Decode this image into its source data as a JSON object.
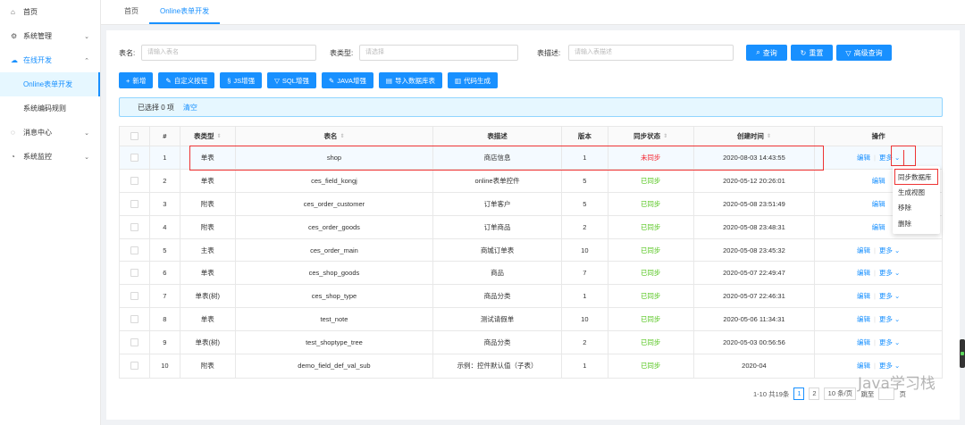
{
  "sidebar": {
    "items": [
      {
        "label": "首页",
        "icon": "home-icon"
      },
      {
        "label": "系统管理",
        "icon": "gear-icon"
      },
      {
        "label": "在线开发",
        "icon": "cloud-icon"
      },
      {
        "label": "Online表单开发"
      },
      {
        "label": "系统编码规则"
      },
      {
        "label": "消息中心",
        "icon": "message-icon"
      },
      {
        "label": "系统监控",
        "icon": "monitor-icon"
      }
    ]
  },
  "tabs": [
    "首页",
    "Online表单开发"
  ],
  "search": {
    "table_name_label": "表名:",
    "table_name_placeholder": "请输入表名",
    "table_type_label": "表类型:",
    "table_type_placeholder": "请选择",
    "table_desc_label": "表描述:",
    "table_desc_placeholder": "请输入表描述",
    "query": "查询",
    "reset": "重置",
    "advanced": "高级查询"
  },
  "toolbar": [
    "新增",
    "自定义按钮",
    "JS增强",
    "SQL增强",
    "JAVA增强",
    "导入数据库表",
    "代码生成"
  ],
  "alert": {
    "selected": "已选择 0 项",
    "clear": "清空"
  },
  "table": {
    "headers": [
      "#",
      "表类型",
      "表名",
      "表描述",
      "版本",
      "同步状态",
      "创建时间",
      "操作"
    ],
    "rows": [
      {
        "no": "1",
        "type": "单表",
        "name": "shop",
        "desc": "商店信息",
        "ver": "1",
        "sync": "未同步",
        "time": "2020-08-03 14:43:55"
      },
      {
        "no": "2",
        "type": "单表",
        "name": "ces_field_kongj",
        "desc": "online表单控件",
        "ver": "5",
        "sync": "已同步",
        "time": "2020-05-12 20:26:01"
      },
      {
        "no": "3",
        "type": "附表",
        "name": "ces_order_customer",
        "desc": "订单客户",
        "ver": "5",
        "sync": "已同步",
        "time": "2020-05-08 23:51:49"
      },
      {
        "no": "4",
        "type": "附表",
        "name": "ces_order_goods",
        "desc": "订单商品",
        "ver": "2",
        "sync": "已同步",
        "time": "2020-05-08 23:48:31"
      },
      {
        "no": "5",
        "type": "主表",
        "name": "ces_order_main",
        "desc": "商城订单表",
        "ver": "10",
        "sync": "已同步",
        "time": "2020-05-08 23:45:32"
      },
      {
        "no": "6",
        "type": "单表",
        "name": "ces_shop_goods",
        "desc": "商品",
        "ver": "7",
        "sync": "已同步",
        "time": "2020-05-07 22:49:47"
      },
      {
        "no": "7",
        "type": "单表(树)",
        "name": "ces_shop_type",
        "desc": "商品分类",
        "ver": "1",
        "sync": "已同步",
        "time": "2020-05-07 22:46:31"
      },
      {
        "no": "8",
        "type": "单表",
        "name": "test_note",
        "desc": "测试请假单",
        "ver": "10",
        "sync": "已同步",
        "time": "2020-05-06 11:34:31"
      },
      {
        "no": "9",
        "type": "单表(树)",
        "name": "test_shoptype_tree",
        "desc": "商品分类",
        "ver": "2",
        "sync": "已同步",
        "time": "2020-05-03 00:56:56"
      },
      {
        "no": "10",
        "type": "附表",
        "name": "demo_field_def_val_sub",
        "desc": "示例：控件默认值（子表）",
        "ver": "1",
        "sync": "已同步",
        "time": "2020-04"
      }
    ],
    "edit": "编辑",
    "more": "更多"
  },
  "dropdown": [
    "同步数据库",
    "生成视图",
    "移除",
    "删除"
  ],
  "pager": {
    "summary": "1-10 共19条",
    "page1": "1",
    "page2": "2",
    "page_size": "10 条/页",
    "jump": "跳至",
    "page_suffix": "页"
  },
  "watermark": "Java学习栈",
  "colors": {
    "primary": "#1890ff",
    "synced": "#52c41a",
    "unsynced": "#f5222d",
    "highlight": "#e33333"
  }
}
